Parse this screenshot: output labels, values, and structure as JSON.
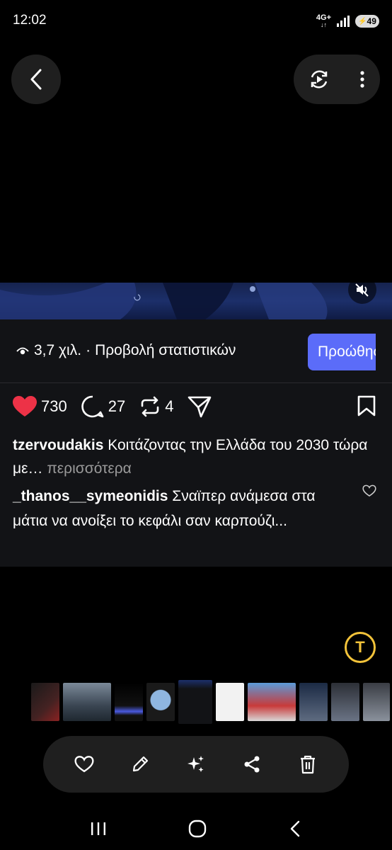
{
  "status_bar": {
    "time": "12:02",
    "network": "4G+",
    "battery": "49"
  },
  "top_bar": {
    "back_icon": "chevron-left-icon",
    "motion_icon": "play-rotate-icon",
    "more_icon": "more-vertical-icon"
  },
  "post": {
    "views": "3,7 χιλ.",
    "stats_separator": "·",
    "stats_link": "Προβολή στατιστικών",
    "promote_button": "Προώθηση",
    "likes": "730",
    "comments": "27",
    "reposts": "4",
    "caption_user": "tzervoudakis",
    "caption_text": "Κοιτάζοντας την Ελλάδα του 2030 τώρα με…",
    "caption_more": "περισσότερα",
    "comment_user": "_thanos__symeonidis",
    "comment_text": "Σναϊπερ ανάμεσα στα μάτια να ανοίξει το κεφάλι σαν καρπούζι..."
  },
  "colors": {
    "like_red": "#ed3247",
    "promote_blue": "#5b6cf9",
    "ocr_yellow": "#f3c33a",
    "card_bg": "#121316"
  },
  "toolbar": {
    "items": [
      "heart-icon",
      "edit-icon",
      "sparkle-icon",
      "share-icon",
      "trash-icon"
    ]
  },
  "navbar": {
    "items": [
      "recent-apps-icon",
      "home-icon",
      "back-icon"
    ]
  }
}
